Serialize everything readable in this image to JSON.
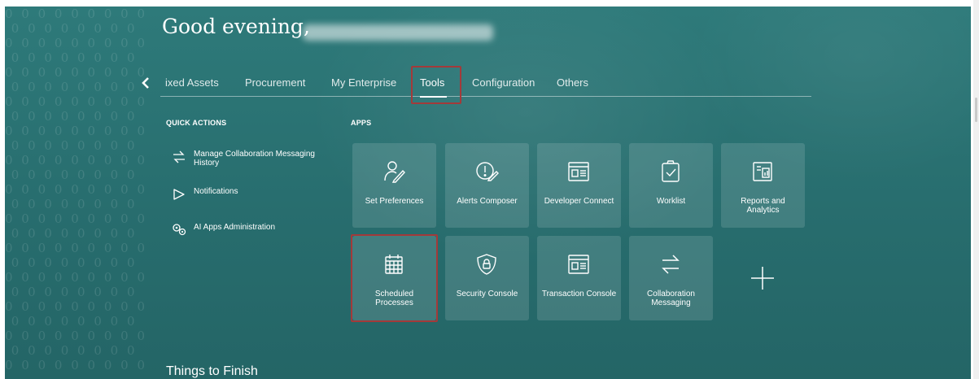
{
  "header": {
    "greeting": "Good evening,"
  },
  "nav": {
    "back_icon": "chevron-left-icon",
    "tabs": [
      {
        "label": "Fixed Assets",
        "shown": "ixed Assets"
      },
      {
        "label": "Procurement"
      },
      {
        "label": "My Enterprise"
      },
      {
        "label": "Tools",
        "selected": true
      },
      {
        "label": "Configuration"
      },
      {
        "label": "Others"
      }
    ]
  },
  "quick_actions": {
    "title": "QUICK ACTIONS",
    "items": [
      {
        "label": "Manage Collaboration Messaging History",
        "icon": "collaboration-arrows-icon"
      },
      {
        "label": "Notifications",
        "icon": "notification-play-icon"
      },
      {
        "label": "AI Apps Administration",
        "icon": "gears-icon"
      }
    ]
  },
  "apps": {
    "title": "APPS",
    "tiles": [
      {
        "label": "Set Preferences",
        "icon": "person-pencil-icon"
      },
      {
        "label": "Alerts Composer",
        "icon": "alert-composer-icon"
      },
      {
        "label": "Developer Connect",
        "icon": "developer-connect-icon"
      },
      {
        "label": "Worklist",
        "icon": "clipboard-check-icon"
      },
      {
        "label": "Reports and Analytics",
        "icon": "report-chart-icon"
      },
      {
        "label": "Scheduled Processes",
        "icon": "calendar-icon"
      },
      {
        "label": "Security Console",
        "icon": "shield-lock-icon"
      },
      {
        "label": "Transaction Console",
        "icon": "transaction-console-icon"
      },
      {
        "label": "Collaboration Messaging",
        "icon": "collaboration-arrows-icon"
      }
    ],
    "add_icon": "plus-icon"
  },
  "things_to_finish": {
    "title": "Things to Finish"
  },
  "colors": {
    "background": "#2b7474",
    "highlight": "#a33a3a",
    "text": "#ffffff"
  }
}
